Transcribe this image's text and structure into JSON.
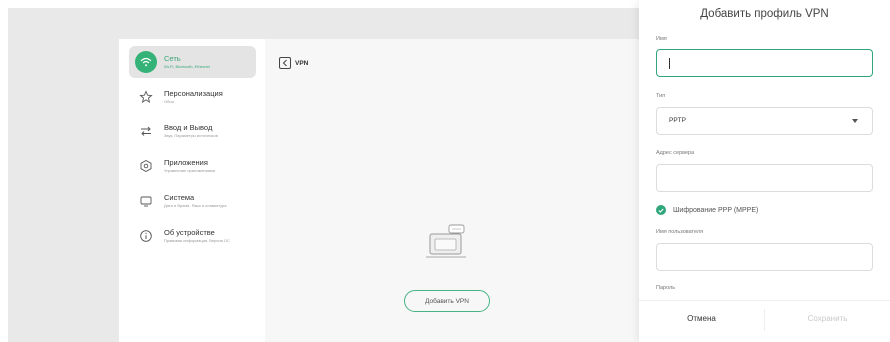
{
  "sidebar": {
    "items": [
      {
        "title": "Сеть",
        "subtitle": "Wi-Fi, Bluetooth, Ethernet",
        "icon": "wifi-icon",
        "active": true
      },
      {
        "title": "Персонализация",
        "subtitle": "Обои",
        "icon": "star-icon"
      },
      {
        "title": "Ввод и Вывод",
        "subtitle": "Звук, Параметры источников",
        "icon": "arrows-icon"
      },
      {
        "title": "Приложения",
        "subtitle": "Управление приложениями",
        "icon": "apps-icon"
      },
      {
        "title": "Система",
        "subtitle": "Дата и Время, Язык и клавиатура",
        "icon": "monitor-icon"
      },
      {
        "title": "Об устройстве",
        "subtitle": "Правовая информация, Версия ОС",
        "icon": "info-icon"
      }
    ]
  },
  "main": {
    "breadcrumb": "VPN",
    "add_button": "Добавить VPN"
  },
  "dialog": {
    "title": "Добавить профиль VPN",
    "name_label": "Имя",
    "name_value": "",
    "type_label": "Тип",
    "type_value": "PPTP",
    "server_label": "Адрес сервера",
    "server_value": "",
    "encryption_label": "Шифрование PPP (MPPE)",
    "encryption_checked": true,
    "username_label": "Имя пользователя",
    "username_value": "",
    "password_label": "Пароль",
    "cancel": "Отмена",
    "save": "Сохранить"
  },
  "colors": {
    "accent": "#2fa67a",
    "backdrop": "#e9e9e9"
  }
}
